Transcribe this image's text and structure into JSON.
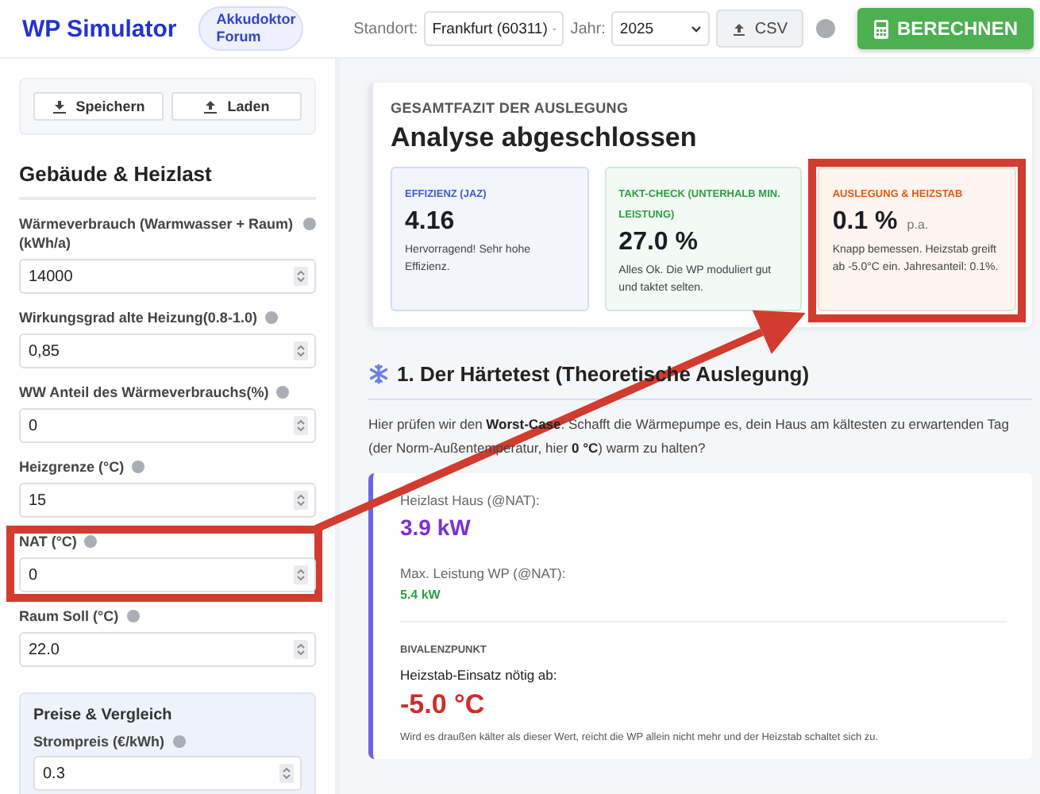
{
  "header": {
    "title": "WP Simulator",
    "forum_badge": "Akkudoktor Forum",
    "location_label": "Standort:",
    "location_value": "Frankfurt (60311)",
    "year_label": "Jahr:",
    "year_value": "2025",
    "csv_button": "CSV",
    "calculate_button": "BERECHNEN"
  },
  "sidebar": {
    "actions": [
      "Speichern",
      "Laden"
    ],
    "section_title": "Gebäude & Heizlast",
    "fields": [
      {
        "label": "Wärmeverbrauch (Warmwasser + Raum) (kWh/a)",
        "value": "14000",
        "highlighted": false
      },
      {
        "label": "Wirkungsgrad alte Heizung(0.8-1.0)",
        "value": "0,85",
        "highlighted": false
      },
      {
        "label": "WW Anteil des Wärmeverbrauchs(%)",
        "value": "0",
        "highlighted": false
      },
      {
        "label": "Heizgrenze (°C)",
        "value": "15",
        "highlighted": false
      },
      {
        "label": "NAT (°C)",
        "value": "0",
        "highlighted": true
      },
      {
        "label": "Raum Soll (°C)",
        "value": "22.0",
        "highlighted": false
      }
    ],
    "prices": {
      "title": "Preise & Vergleich",
      "fields": [
        {
          "label": "Strompreis (€/kWh)",
          "value": "0.3"
        }
      ]
    }
  },
  "summary": {
    "eyebrow": "GESAMTFAZIT DER AUSLEGUNG",
    "title": "Analyse abgeschlossen",
    "cards": [
      {
        "label": "EFFIZIENZ (JAZ)",
        "value": "4.16",
        "text": "Hervorragend! Sehr hohe Effizienz.",
        "color": "#3b5bdb",
        "highlighted": false
      },
      {
        "label": "TAKT-CHECK (UNTERHALB MIN. LEISTUNG)",
        "value": "27.0 %",
        "text": "Alles Ok. Die WP moduliert gut und taktet selten.",
        "color": "#2f9e44",
        "highlighted": false
      },
      {
        "label": "AUSLEGUNG & HEIZSTAB",
        "value": "0.1 %",
        "unit": "p.a.",
        "text": "Knapp bemessen. Heizstab greift ab -5.0°C ein. Jahresanteil: 0.1%.",
        "color": "#e8590c",
        "highlighted": true
      }
    ]
  },
  "section": {
    "title": "1. Der Härtetest (Theoretische Auslegung)",
    "intro": "Hier prüfen wir den **Worst-Case**: Schafft die Wärmepumpe es, dein Haus am kältesten zu erwartenden Tag (der Norm-Außentemperatur, hier **0 °C**) warm zu halten?",
    "results": [
      {
        "kind": "primary",
        "label": "Heizlast Haus (@NAT):",
        "value": "3.9 kW",
        "color": "#7b2fd6"
      },
      {
        "kind": "secondary",
        "label": "Max. Leistung WP (@NAT):",
        "value": "5.4 kW",
        "color": "#2f9e44"
      }
    ],
    "bivalence": {
      "eyebrow": "BIVALENZPUNKT",
      "label": "Heizstab-Einsatz nötig ab:",
      "value": "-5.0 °C",
      "note": "Wird es draußen kälter als dieser Wert, reicht die WP allein nicht mehr und der Heizstab schaltet sich zu."
    }
  }
}
